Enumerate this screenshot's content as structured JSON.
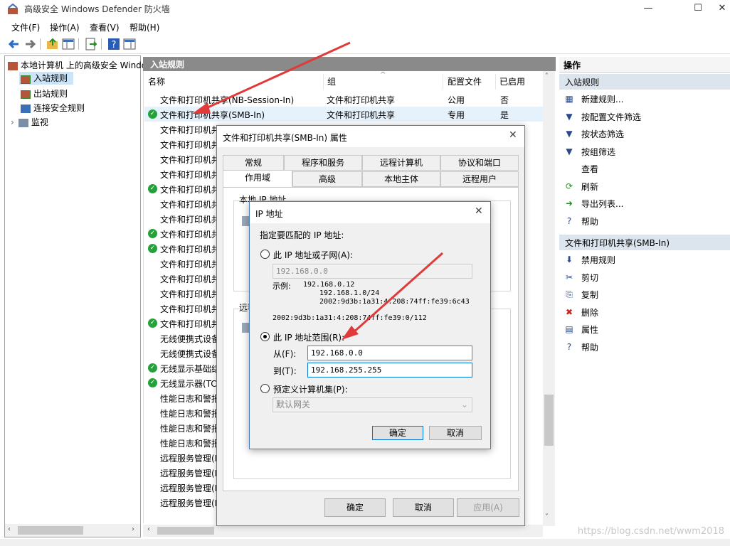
{
  "window": {
    "title": "高级安全 Windows Defender 防火墙",
    "minimize": "—",
    "maximize": "☐",
    "close": "✕"
  },
  "menu": [
    "文件(F)",
    "操作(A)",
    "查看(V)",
    "帮助(H)"
  ],
  "tree": {
    "root": "本地计算机 上的高级安全 Windows Defender 防火墙",
    "items": [
      "入站规则",
      "出站规则",
      "连接安全规则",
      "监视"
    ]
  },
  "center": {
    "header": "入站规则",
    "columns": [
      "名称",
      "组",
      "配置文件",
      "已启用"
    ],
    "rows": [
      {
        "name": "文件和打印机共享(NB-Session-In)",
        "group": "文件和打印机共享",
        "profile": "公用",
        "enabled": "否",
        "ok": false
      },
      {
        "name": "文件和打印机共享(SMB-In)",
        "group": "文件和打印机共享",
        "profile": "专用",
        "enabled": "是",
        "ok": true
      },
      {
        "name": "文件和打印机共",
        "ok": false
      },
      {
        "name": "文件和打印机共",
        "ok": false
      },
      {
        "name": "文件和打印机共",
        "ok": false
      },
      {
        "name": "文件和打印机共",
        "ok": false
      },
      {
        "name": "文件和打印机共",
        "ok": true
      },
      {
        "name": "文件和打印机共",
        "ok": false
      },
      {
        "name": "文件和打印机共",
        "ok": false
      },
      {
        "name": "文件和打印机共",
        "ok": true
      },
      {
        "name": "文件和打印机共",
        "ok": true
      },
      {
        "name": "文件和打印机共",
        "ok": false
      },
      {
        "name": "文件和打印机共",
        "ok": false
      },
      {
        "name": "文件和打印机共",
        "ok": false
      },
      {
        "name": "文件和打印机共",
        "ok": false
      },
      {
        "name": "文件和打印机共",
        "ok": true
      },
      {
        "name": "无线便携式设备",
        "ok": false
      },
      {
        "name": "无线便携式设备",
        "ok": false
      },
      {
        "name": "无线显示基础结",
        "ok": true
      },
      {
        "name": "无线显示器(TC",
        "ok": true
      },
      {
        "name": "性能日志和警报",
        "ok": false
      },
      {
        "name": "性能日志和警报",
        "ok": false
      },
      {
        "name": "性能日志和警报",
        "ok": false
      },
      {
        "name": "性能日志和警报",
        "ok": false
      },
      {
        "name": "远程服务管理(I",
        "ok": false
      },
      {
        "name": "远程服务管理(I",
        "ok": false
      },
      {
        "name": "远程服务管理(I",
        "ok": false
      },
      {
        "name": "远程服务管理(I",
        "ok": false
      }
    ]
  },
  "actions": {
    "title": "操作",
    "section1": "入站规则",
    "items1": [
      {
        "icon": "new-rule-icon",
        "glyph": "▦",
        "label": "新建规则..."
      },
      {
        "icon": "filter-icon",
        "glyph": "▼",
        "label": "按配置文件筛选"
      },
      {
        "icon": "filter-icon",
        "glyph": "▼",
        "label": "按状态筛选"
      },
      {
        "icon": "filter-icon",
        "glyph": "▼",
        "label": "按组筛选"
      },
      {
        "icon": "",
        "glyph": "",
        "label": "查看"
      },
      {
        "icon": "refresh-icon",
        "glyph": "⟳",
        "label": "刷新"
      },
      {
        "icon": "export-icon",
        "glyph": "➜",
        "label": "导出列表..."
      },
      {
        "icon": "help-icon",
        "glyph": "?",
        "label": "帮助"
      }
    ],
    "section2": "文件和打印机共享(SMB-In)",
    "items2": [
      {
        "icon": "disable-icon",
        "glyph": "⬇",
        "label": "禁用规则"
      },
      {
        "icon": "cut-icon",
        "glyph": "✂",
        "label": "剪切"
      },
      {
        "icon": "copy-icon",
        "glyph": "⎘",
        "label": "复制"
      },
      {
        "icon": "delete-icon",
        "glyph": "✖",
        "label": "删除"
      },
      {
        "icon": "properties-icon",
        "glyph": "▤",
        "label": "属性"
      },
      {
        "icon": "help-icon",
        "glyph": "?",
        "label": "帮助"
      }
    ]
  },
  "props_dialog": {
    "title": "文件和打印机共享(SMB-In) 属性",
    "tabs_row1": [
      "常规",
      "程序和服务",
      "远程计算机",
      "协议和端口"
    ],
    "tabs_row2": [
      "作用域",
      "高级",
      "本地主体",
      "远程用户"
    ],
    "local_ip_label": "本地 IP 地址",
    "remote_label": "远程",
    "ok": "确定",
    "cancel": "取消",
    "apply": "应用(A)"
  },
  "ip_dialog": {
    "title": "IP 地址",
    "prompt": "指定要匹配的 IP 地址:",
    "opt1": "此 IP 地址或子网(A):",
    "opt1_value": "192.168.0.0",
    "example_label": "示例:",
    "examples": [
      "192.168.0.12",
      "192.168.1.0/24",
      "2002:9d3b:1a31:4:208:74ff:fe39:6c43",
      "2002:9d3b:1a31:4:208:74ff:fe39:0/112"
    ],
    "opt2": "此 IP 地址范围(R):",
    "from_label": "从(F):",
    "from_value": "192.168.0.0",
    "to_label": "到(T):",
    "to_value": "192.168.255.255",
    "opt3": "预定义计算机集(P):",
    "opt3_value": "默认网关",
    "ok": "确定",
    "cancel": "取消"
  },
  "watermark": "https://blog.csdn.net/wwm2018",
  "colors": {
    "accent": "#0078d7",
    "arrow": "#e03a3a",
    "header": "#8a8a8a",
    "action_head": "#dce4ee"
  }
}
